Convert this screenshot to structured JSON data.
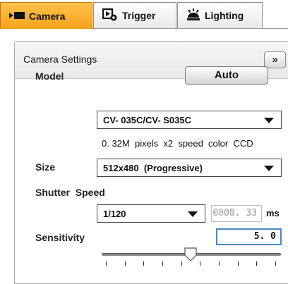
{
  "tabs": [
    {
      "label": "Camera",
      "active": true,
      "icon": "camera-icon"
    },
    {
      "label": "Trigger",
      "active": false,
      "icon": "trigger-icon"
    },
    {
      "label": "Lighting",
      "active": false,
      "icon": "lighting-icon"
    }
  ],
  "panel": {
    "title": "Camera Settings",
    "expand_label": "»"
  },
  "model": {
    "label": "Model",
    "auto_button": "Auto",
    "selected": "CV- 035C/CV- S035C",
    "description": "0. 32M  pixels  x2  speed  color  CCD"
  },
  "size": {
    "label": "Size",
    "selected": "512x480  (Progressive)"
  },
  "shutter": {
    "label": "Shutter  Speed",
    "selected": "1/120",
    "value": "0008. 33",
    "unit": "ms"
  },
  "sensitivity": {
    "label": "Sensitivity",
    "value": "5. 0",
    "slider_fraction": 0.5,
    "tick_count": 10
  },
  "colors": {
    "active_tab": "#f7a21c",
    "focus_border": "#4a86c4"
  }
}
